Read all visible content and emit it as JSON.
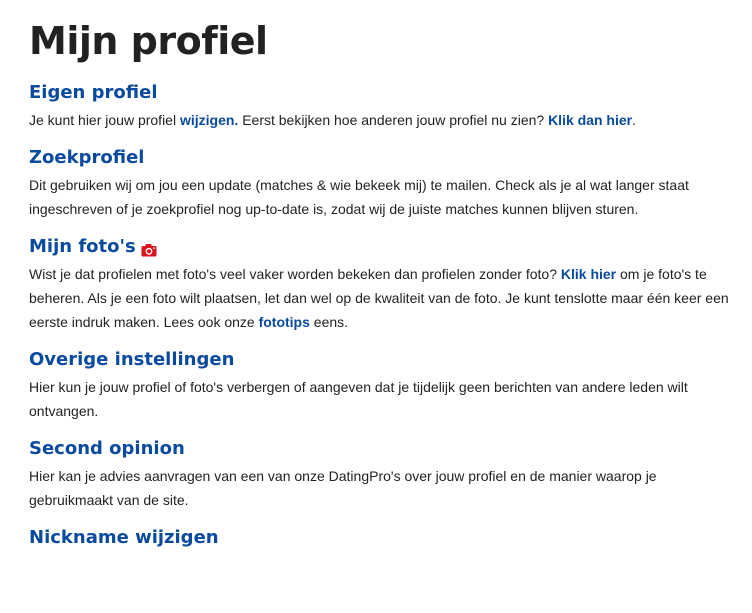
{
  "page": {
    "title": "Mijn profiel"
  },
  "colors": {
    "heading": "#0a4a9e",
    "link": "#0a4a9e",
    "text": "#222222",
    "camera_icon": "#d9141c"
  },
  "sections": {
    "eigen_profiel": {
      "heading": "Eigen profiel",
      "text_1": "Je kunt hier jouw profiel ",
      "link_1": "wijzigen.",
      "text_2": " Eerst bekijken hoe anderen jouw profiel nu zien? ",
      "link_2": "Klik dan hier",
      "text_3": "."
    },
    "zoekprofiel": {
      "heading": "Zoekprofiel",
      "text": "Dit gebruiken wij om jou een update (matches & wie bekeek mij) te mailen. Check als je al wat langer staat ingeschreven of je zoekprofiel nog up-to-date is, zodat wij de juiste matches kunnen blijven sturen."
    },
    "mijn_fotos": {
      "heading": "Mijn foto's",
      "icon": "camera-icon",
      "text_1": "Wist je dat profielen met foto's veel vaker worden bekeken dan profielen zonder foto? ",
      "link_1": "Klik hier",
      "text_2": " om je foto's te beheren. Als je een foto wilt plaatsen, let dan wel op de kwaliteit van de foto. Je kunt tenslotte maar één keer een eerste indruk maken. Lees ook onze ",
      "link_2": "fototips",
      "text_3": " eens."
    },
    "overige_instellingen": {
      "heading": "Overige instellingen",
      "text": "Hier kun je jouw profiel of foto's verbergen of aangeven dat je tijdelijk geen berichten van andere leden wilt ontvangen."
    },
    "second_opinion": {
      "heading": "Second opinion",
      "text": "Hier kan je advies aanvragen van een van onze DatingPro's over jouw profiel en de manier waarop je gebruikmaakt van de site."
    },
    "nickname_wijzigen": {
      "heading": "Nickname wijzigen"
    }
  }
}
